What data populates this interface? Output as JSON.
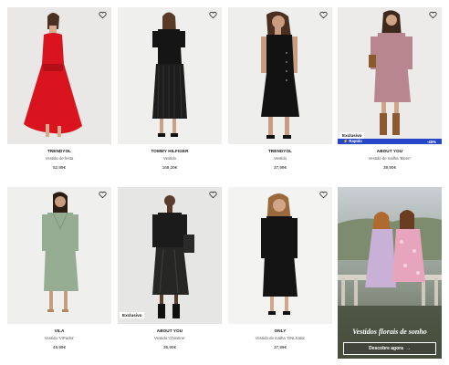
{
  "products": [
    {
      "brand": "TRENDYOL",
      "description": "Vestido de festa",
      "price": "52,99€"
    },
    {
      "brand": "TOMMY HILFIGER",
      "description": "Vestido",
      "price": "169,20€"
    },
    {
      "brand": "TRENDYOL",
      "description": "Vestido",
      "price": "37,99€"
    },
    {
      "brand": "ABOUT YOU",
      "description": "Vestido de malha 'Bleen'",
      "price": "39,90€",
      "badge": "Exclusivo",
      "deal_label": "Rapido",
      "deal_value": "-45%"
    },
    {
      "brand": "VILA",
      "description": "Vestido 'VIPadra'",
      "price": "49,99€"
    },
    {
      "brand": "ABOUT YOU",
      "description": "Vestido 'Christine'",
      "price": "39,90€",
      "badge": "Exclusivo"
    },
    {
      "brand": "ONLY",
      "description": "Vestido de malha 'ONLKatia'",
      "price": "37,99€"
    }
  ],
  "promo": {
    "title": "Vestidos florais de sonho",
    "cta_label": "Descobre agora",
    "cta_icon": "arrow-right-icon"
  },
  "icons": {
    "favorite": "heart-outline-icon"
  },
  "colors": {
    "deal_bar": "#2747c9",
    "text": "#111111"
  }
}
